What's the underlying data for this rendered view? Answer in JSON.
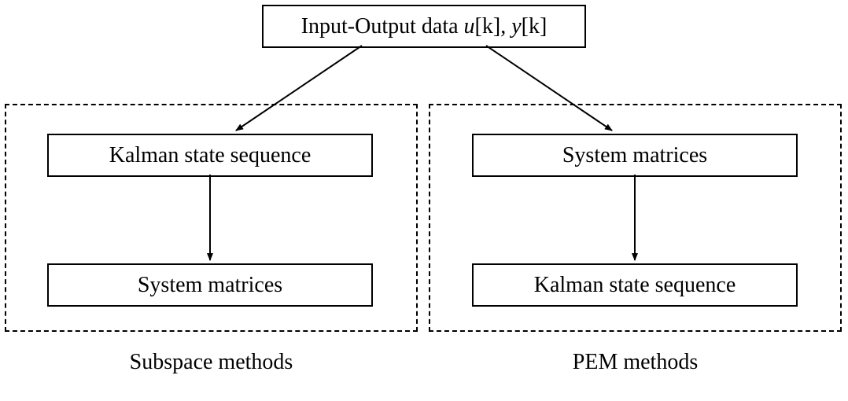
{
  "top_box": {
    "prefix": "Input-Output data ",
    "u": "u",
    "uk": "[k]",
    "sep": ", ",
    "y": "y",
    "yk": "[k]"
  },
  "left": {
    "step1": "Kalman state sequence",
    "step2": "System matrices",
    "title": "Subspace methods"
  },
  "right": {
    "step1": "System matrices",
    "step2": "Kalman state sequence",
    "title": "PEM methods"
  }
}
